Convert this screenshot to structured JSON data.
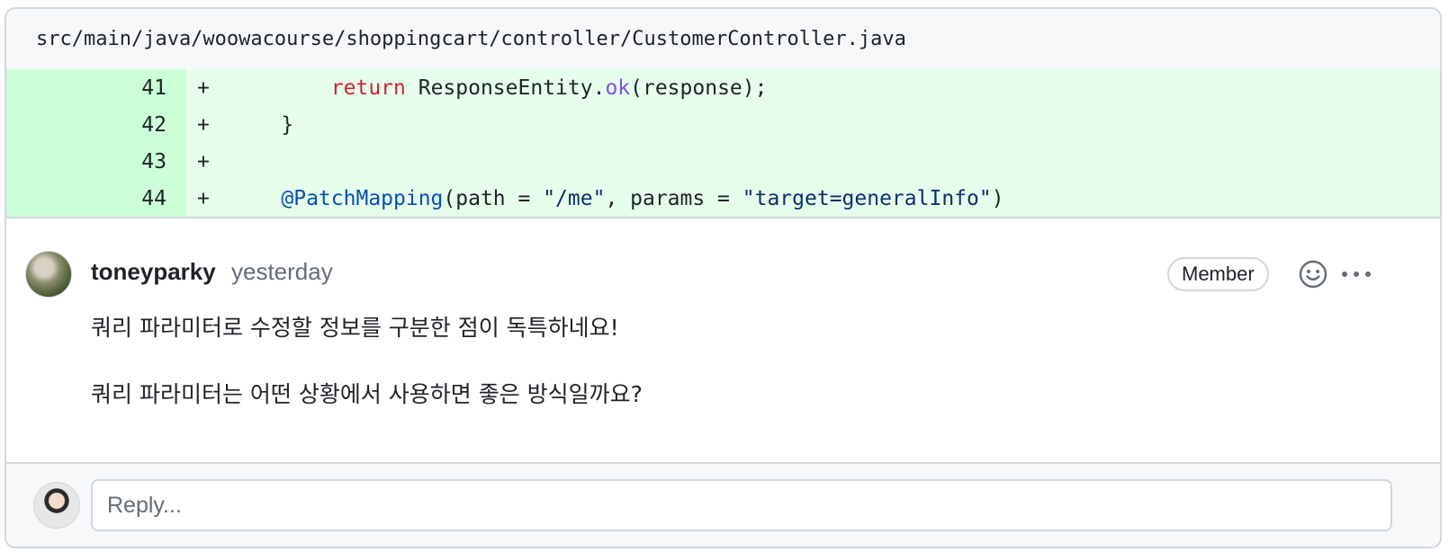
{
  "file": {
    "path": "src/main/java/woowacourse/shoppingcart/controller/CustomerController.java"
  },
  "diff_lines": [
    {
      "num": "41",
      "sign": "+",
      "indent": "        ",
      "tokens": [
        [
          "kw",
          "return"
        ],
        [
          "",
          " ResponseEntity."
        ],
        [
          "fn",
          "ok"
        ],
        [
          "",
          "(response);"
        ]
      ]
    },
    {
      "num": "42",
      "sign": "+",
      "indent": "    ",
      "tokens": [
        [
          "",
          "}"
        ]
      ]
    },
    {
      "num": "43",
      "sign": "+",
      "indent": "",
      "tokens": []
    },
    {
      "num": "44",
      "sign": "+",
      "indent": "    ",
      "tokens": [
        [
          "an",
          "@PatchMapping"
        ],
        [
          "",
          "(path = "
        ],
        [
          "str",
          "\"/me\""
        ],
        [
          "",
          ", params = "
        ],
        [
          "str",
          "\"target=generalInfo\""
        ],
        [
          "",
          ")"
        ]
      ]
    }
  ],
  "comment": {
    "author": "toneyparky",
    "time": "yesterday",
    "badge": "Member",
    "paragraphs": [
      "쿼리 파라미터로 수정할 정보를 구분한 점이 독특하네요!",
      "쿼리 파라미터는 어떤 상황에서 사용하면 좋은 방식일까요?"
    ]
  },
  "reply": {
    "placeholder": "Reply..."
  },
  "icons": {
    "reaction": "smiley-icon",
    "more": "kebab-horizontal-icon"
  },
  "colors": {
    "added_bg": "#e6ffec",
    "added_num_bg": "#ccffd8",
    "keyword": "#cf222e",
    "function": "#8250df",
    "annotation": "#0550ae",
    "string": "#0a3069"
  }
}
